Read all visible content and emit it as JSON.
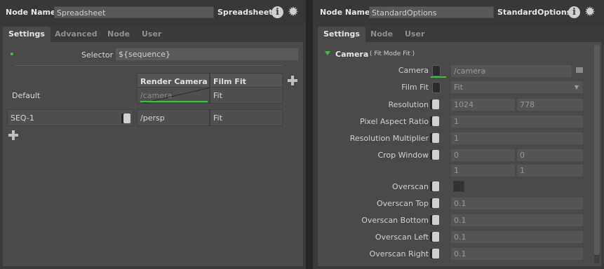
{
  "left": {
    "node_name_label": "Node Name",
    "node_name_value": "Spreadsheet",
    "node_type": "Spreadsheet",
    "tabs": [
      "Settings",
      "Advanced",
      "Node",
      "User"
    ],
    "selector_label": "Selector",
    "selector_value": "${sequence}",
    "columns": [
      "Render Camera",
      "Film Fit"
    ],
    "default_row": {
      "label": "Default",
      "camera": "/camera",
      "fit": "Fit"
    },
    "rows": [
      {
        "name": "SEQ-1",
        "camera": "/persp",
        "fit": "Fit"
      }
    ]
  },
  "right": {
    "node_name_label": "Node Name",
    "node_name_value": "StandardOptions",
    "node_type": "StandardOptions",
    "tabs": [
      "Settings",
      "Node",
      "User"
    ],
    "section_title": "Camera",
    "section_summary": "( Fit Mode Fit )",
    "camera_label": "Camera",
    "camera_value": "/camera",
    "filmfit_label": "Film Fit",
    "filmfit_value": "Fit",
    "resolution_label": "Resolution",
    "resolution_x": "1024",
    "resolution_y": "778",
    "par_label": "Pixel Aspect Ratio",
    "par_value": "1",
    "resmult_label": "Resolution Multiplier",
    "resmult_value": "1",
    "crop_label": "Crop Window",
    "crop_min_x": "0",
    "crop_min_y": "0",
    "crop_max_x": "1",
    "crop_max_y": "1",
    "overscan_label": "Overscan",
    "overscan_top_label": "Overscan Top",
    "overscan_top": "0.1",
    "overscan_bottom_label": "Overscan Bottom",
    "overscan_bottom": "0.1",
    "overscan_left_label": "Overscan Left",
    "overscan_left": "0.1",
    "overscan_right_label": "Overscan Right",
    "overscan_right": "0.1"
  },
  "colors": {
    "accent_green": "#3fbf3f",
    "panel_bg": "#3a3a3a"
  }
}
